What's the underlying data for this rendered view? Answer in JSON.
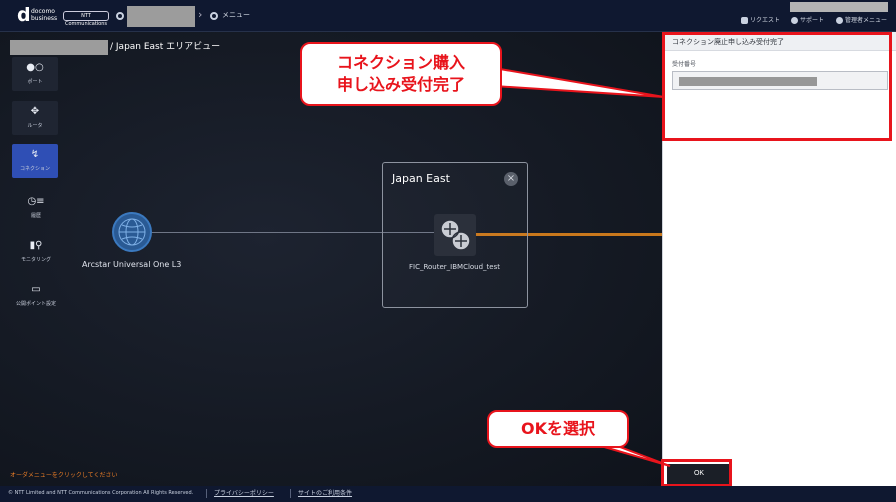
{
  "header": {
    "logo_mark": "d",
    "logo_text_line1": "docomo",
    "logo_text_line2": "business",
    "ntt_badge": "NTT Communications",
    "menu_label": "メニュー",
    "links": {
      "request": "リクエスト",
      "support": "サポート",
      "admin_menu": "管理者メニュー"
    }
  },
  "main": {
    "area_title": "/ Japan East エリアビュー",
    "rail": [
      {
        "icon": "port-icon",
        "glyph": "●○",
        "label": "ポート"
      },
      {
        "icon": "router-icon",
        "glyph": "✥",
        "label": "ルータ"
      },
      {
        "icon": "connection-icon",
        "glyph": "↯",
        "label": "コネクション"
      },
      {
        "icon": "history-icon",
        "glyph": "◷≡",
        "label": "履歴"
      },
      {
        "icon": "monitoring-icon",
        "glyph": "▮⚲",
        "label": "モニタリング"
      },
      {
        "icon": "public-point-icon",
        "glyph": "▭",
        "label": "公開ポイント設定"
      }
    ],
    "globe_label": "Arcstar Universal One L3",
    "region": {
      "title": "Japan East",
      "close_glyph": "×",
      "router_label": "FIC_Router_IBMCloud_test"
    },
    "hint": "オーダメニューをクリックしてください"
  },
  "panel": {
    "title": "コネクション廃止申し込み受付完了",
    "receipt_label": "受付番号",
    "ok_label": "OK"
  },
  "annotations": {
    "callout_complete": "コネクション購入\n申し込み受付完了",
    "callout_ok": "OKを選択",
    "color": "#e8141c"
  },
  "footer": {
    "copyright": "© NTT Limited and NTT Communications Corporation All Rights Reserved.",
    "privacy": "プライバシーポリシー",
    "terms": "サイトのご利用条件"
  }
}
